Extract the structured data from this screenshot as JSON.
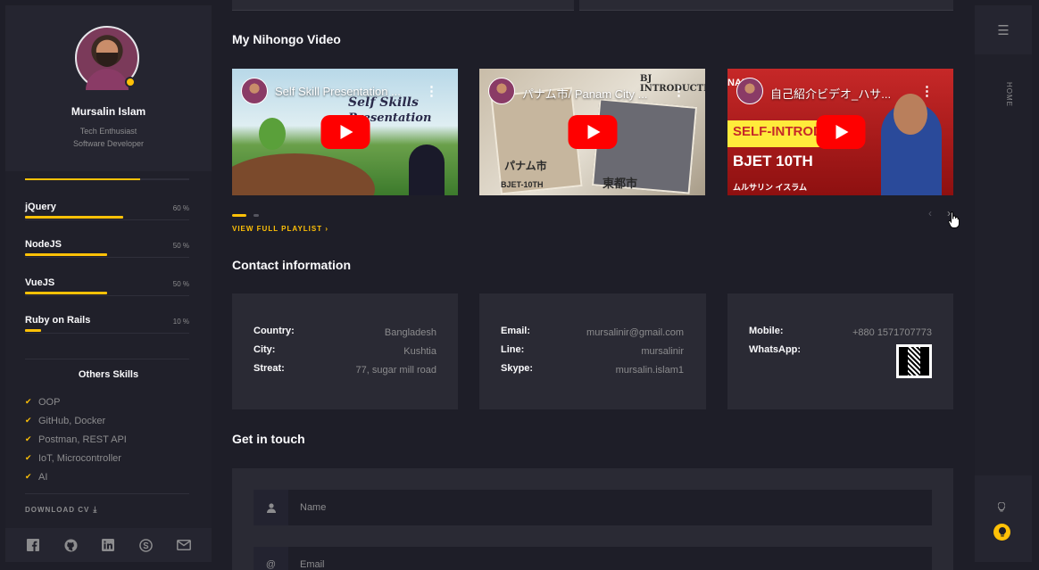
{
  "profile": {
    "name": "Mursalin Islam",
    "role1": "Tech Enthusiast",
    "role2": "Software Developer"
  },
  "skills": [
    {
      "name": "jQuery",
      "percent_label": "60 %",
      "level": 0.6
    },
    {
      "name": "NodeJS",
      "percent_label": "50 %",
      "level": 0.5
    },
    {
      "name": "VueJS",
      "percent_label": "50 %",
      "level": 0.5
    },
    {
      "name": "Ruby on Rails",
      "percent_label": "10 %",
      "level": 0.1
    }
  ],
  "skill_above_level": 0.7,
  "others": {
    "title": "Others Skills",
    "items": [
      "OOP",
      "GitHub, Docker",
      "Postman, REST API",
      "IoT, Microcontroller",
      "AI"
    ]
  },
  "download_cv": "DOWNLOAD CV",
  "social_icons": [
    "facebook-icon",
    "github-icon",
    "linkedin-icon",
    "skype-icon",
    "mail-icon"
  ],
  "videos_section": {
    "title": "My Nihongo Video",
    "videos": [
      {
        "title": "Self Skill Presentation ...",
        "captions": [
          "Self Skills",
          "Presentation"
        ]
      },
      {
        "title": "パナム市/ Panam City ...",
        "captions": [
          "BJ INTRODUCTION",
          "東都市",
          "パナム市",
          "BJET-10TH"
        ]
      },
      {
        "title": "自己紹介ビデオ_ハサ...",
        "captions": [
          "SELF-INTRODU",
          "BJET 10TH",
          "ムルサリン イスラム",
          "NAL"
        ]
      }
    ],
    "playlist_link": "VIEW FULL PLAYLIST ›"
  },
  "contact": {
    "title": "Contact information",
    "cards": [
      {
        "rows": [
          {
            "key": "Country:",
            "value": "Bangladesh"
          },
          {
            "key": "City:",
            "value": "Kushtia"
          },
          {
            "key": "Streat:",
            "value": "77, sugar mill road"
          }
        ]
      },
      {
        "rows": [
          {
            "key": "Email:",
            "value": "mursalinir@gmail.com"
          },
          {
            "key": "Line:",
            "value": "mursalinir"
          },
          {
            "key": "Skype:",
            "value": "mursalin.islam1"
          }
        ]
      },
      {
        "rows": [
          {
            "key": "Mobile:",
            "value": "+880 1571707773"
          },
          {
            "key": "WhatsApp:",
            "value": ""
          }
        ]
      }
    ]
  },
  "get_in_touch": {
    "title": "Get in touch",
    "name_placeholder": "Name",
    "email_placeholder": "Email"
  },
  "rail": {
    "home_label": "HOME"
  },
  "colors": {
    "accent": "#ffc107",
    "background": "#1e1e28",
    "panel": "#252530",
    "card": "#2a2a34",
    "muted_text": "#8c8c8e"
  }
}
